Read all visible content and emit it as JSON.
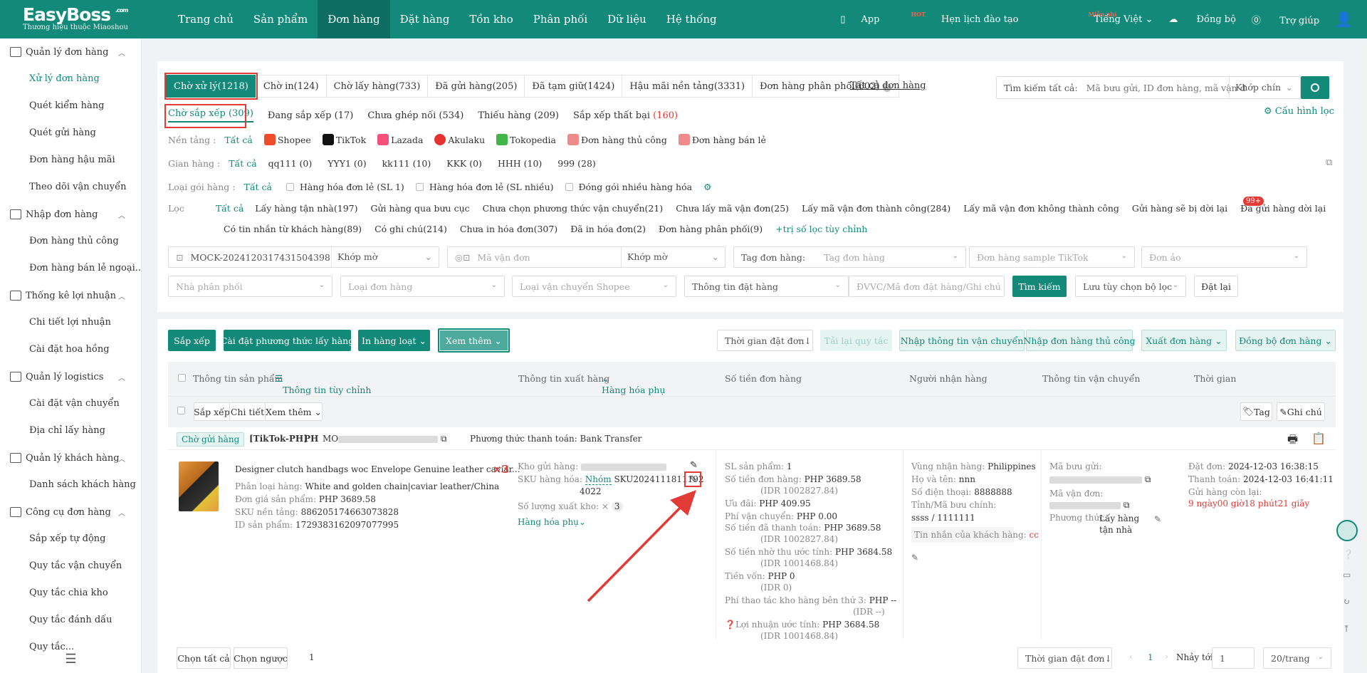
{
  "brand": {
    "name": "EasyBoss",
    "suffix": ".com",
    "tagline": "Thương hiệu thuộc Miaoshou"
  },
  "topnav": [
    "Trang chủ",
    "Sản phẩm",
    "Đơn hàng",
    "Đặt hàng",
    "Tồn kho",
    "Phân phối",
    "Dữ liệu",
    "Hệ thống"
  ],
  "topright": {
    "app": "App",
    "app_badge": "HOT",
    "training": "Hẹn lịch đào tạo",
    "training_badge": "Miễn phí",
    "language": "Tiếng Việt",
    "sync": "Đồng bộ",
    "help": "Trợ giúp"
  },
  "sidebar": [
    {
      "group": "Quản lý đơn hàng",
      "items": [
        "Xử lý đơn hàng",
        "Quét kiểm hàng",
        "Quét gửi hàng",
        "Đơn hàng hậu mãi",
        "Theo dõi vận chuyển"
      ]
    },
    {
      "group": "Nhập đơn hàng",
      "items": [
        "Đơn hàng thủ công",
        "Đơn hàng bán lẻ ngoại..."
      ]
    },
    {
      "group": "Thống kê lợi nhuận",
      "items": [
        "Chi tiết lợi nhuận",
        "Cài đặt hoa hồng"
      ]
    },
    {
      "group": "Quản lý logistics",
      "items": [
        "Cài đặt vận chuyển",
        "Địa chỉ lấy hàng"
      ]
    },
    {
      "group": "Quản lý khách hàng",
      "items": [
        "Danh sách khách hàng"
      ]
    },
    {
      "group": "Công cụ đơn hàng",
      "items": [
        "Sắp xếp tự động",
        "Quy tắc vận chuyển",
        "Quy tắc chia kho",
        "Quy tắc đánh dấu",
        "Quy tắc..."
      ]
    }
  ],
  "status_tabs": [
    "Chờ xử lý(1218)",
    "Chờ in(124)",
    "Chờ lấy hàng(733)",
    "Đã gửi hàng(205)",
    "Đã tạm giữ(1424)",
    "Hậu mãi nền tảng(3331)",
    "Đơn hàng phân phối(602)"
  ],
  "all_orders_link": "Tất cả đơn hàng",
  "search": {
    "label": "Tìm kiếm tất cả:",
    "placeholder": "Mã bưu gửi, ID đơn hàng, mã vận đơn",
    "match": "Khớp chín"
  },
  "config_filter": "Cấu hình lọc",
  "subtabs": [
    {
      "label": "Chờ sắp xếp (309)",
      "count": ""
    },
    {
      "label": "Đang sắp xếp (17)",
      "count": ""
    },
    {
      "label": "Chưa ghép nối (534)",
      "count": ""
    },
    {
      "label": "Thiếu hàng (209)",
      "count": ""
    },
    {
      "label": "Sắp xếp thất bại ",
      "count": "(160)"
    }
  ],
  "filters": {
    "platform_label": "Nền tảng :",
    "platforms": [
      "Tất cả",
      "Shopee",
      "TikTok",
      "Lazada",
      "Akulaku",
      "Tokopedia",
      "Đơn hàng thủ công",
      "Đơn hàng bán lẻ"
    ],
    "shop_label": "Gian hàng :",
    "shops": [
      "Tất cả",
      "qq111 (0)",
      "YYY1 (0)",
      "kk111 (10)",
      "KKK (0)",
      "HHH (10)",
      "999 (28)"
    ],
    "pkg_label": "Loại gói hàng :",
    "pkgs": [
      "Tất cả",
      "Hàng hóa đơn lẻ (SL 1)",
      "Hàng hóa đơn lẻ (SL nhiều)",
      "Đóng gói nhiều hàng hóa"
    ],
    "filter_label": "Lọc",
    "filter_row1": [
      "Tất cả",
      "Lấy hàng tận nhà(197)",
      "Gửi hàng qua bưu cục",
      "Chưa chọn phương thức vận chuyển(21)",
      "Chưa lấy mã vận đơn(25)",
      "Lấy mã vận đơn thành công(284)",
      "Lấy mã vận đơn không thành công",
      "Gửi hàng sẽ bị dời lại",
      "Đã gửi hàng dời lại"
    ],
    "badge": "99+",
    "filter_row2": [
      "Có tin nhắn từ khách hàng(89)",
      "Có ghi chú(214)",
      "Chưa in hóa đơn(307)",
      "Đã in hóa đơn(2)",
      "Đơn hàng phân phối(9)",
      "+trị số lọc tùy chỉnh"
    ]
  },
  "fields": {
    "f1": "MOCK-20241203174315043​98",
    "f1m": "Khớp mờ",
    "f2": "Mã vận đơn",
    "f2m": "Khớp mờ",
    "f3l": "Tag đơn hàng:",
    "f3": "Tag đơn hàng",
    "f4": "Đơn hàng sample TikTok",
    "f5": "Đơn ảo",
    "f6": "Nhà phân phối",
    "f7": "Loại đơn hàng",
    "f8": "Loại vận chuyển Shopee",
    "f9": "Thông tin đặt hàng",
    "f10": "ĐVVC/Mã đơn đặt hàng/Ghi chú",
    "search_btn": "Tìm kiếm",
    "save_btn": "Lưu tùy chọn bộ lọc",
    "reset_btn": "Đặt lại"
  },
  "actions": {
    "sort": "Sắp xếp",
    "pickup": "Cài đặt phương thức lấy hàng",
    "print": "In hàng loạt",
    "more": "Xem thêm",
    "time": "Thời gian đặt đơn↓",
    "reload": "Tải lại quy tắc",
    "import_ship": "Nhập thông tin vận chuyển",
    "import_manual": "Nhập đơn hàng thủ công",
    "export": "Xuất đơn hàng",
    "sync": "Đồng bộ đơn hàng"
  },
  "table_headers": {
    "product": "Thông tin sản phẩm",
    "custom": "Thông tin tùy chỉnh",
    "ship": "Thông tin xuất hàng",
    "sub": "Hàng hóa phụ",
    "amount": "Số tiền đơn hàng",
    "receiver": "Người nhận hàng",
    "logistics": "Thông tin vận chuyển",
    "time": "Thời gian"
  },
  "subbar": {
    "sort": "Sắp xếp",
    "detail": "Chi tiết",
    "more": "Xem thêm",
    "tag": "Tag",
    "note": "Ghi chú"
  },
  "order": {
    "status": "Chờ gửi hàng",
    "shop": "[TikTok-PH]",
    "country": "PH",
    "id_prefix": "MO",
    "payment": "Phương thức thanh toán: Bank Transfer",
    "product_title": "Designer clutch handbags woc Envelope Genuine leather caviar...",
    "qty": "×3",
    "variant_l": "Phân loại hàng:",
    "variant": "White and golden chain|caviar leather/China",
    "price_l": "Đơn giá sản phẩm:",
    "price": "PHP 3689.58",
    "sku_l": "SKU nền tảng:",
    "sku": "886205174663073828",
    "pid_l": "ID sản phẩm:",
    "pid": "1729383162097077995",
    "wh_l": "Kho gửi hàng:",
    "skuh_l": "SKU hàng hóa:",
    "group": "Nhóm",
    "skuh": "SKU2024111811192",
    "skuh2": "4022",
    "outqty_l": "Số lượng xuất kho:",
    "outqty": "3",
    "subgoods": "Hàng hóa phụ",
    "amounts": [
      {
        "l": "SL sản phẩm:",
        "v": "1",
        "s": ""
      },
      {
        "l": "Số tiền đơn hàng:",
        "v": "PHP 3689.58",
        "s": "(IDR 1002827.84)"
      },
      {
        "l": "Ưu đãi:",
        "v": "PHP 409.95",
        "s": ""
      },
      {
        "l": "Phí vận chuyển:",
        "v": "PHP 0.00",
        "s": ""
      },
      {
        "l": "Số tiền đã thanh toán:",
        "v": "PHP 3689.58",
        "s": "(IDR 1002827.84)"
      },
      {
        "l": "Số tiền nhờ thu ước tính:",
        "v": "PHP 3684.58",
        "s": "(IDR 1001468.84)"
      },
      {
        "l": "Tiền vốn:",
        "v": "PHP 0",
        "s": "(IDR 0)"
      },
      {
        "l": "Phí thao tác kho hàng bên thứ 3:",
        "v": "PHP --",
        "s": "(IDR --)"
      },
      {
        "l": "Lợi nhuận ước tính:",
        "v": "PHP 3684.58",
        "s": "(IDR 1001468.84)"
      }
    ],
    "region_l": "Vùng nhận hàng:",
    "region": "Philippines",
    "name_l": "Họ và tên:",
    "name": "nnn",
    "phone_l": "Số điện thoại:",
    "phone": "8888888",
    "prov_l": "Tỉnh/Mã bưu chính:",
    "prov": "ssss / 1111111",
    "msg_l": "Tin nhắn của khách hàng:",
    "msg": "cc",
    "post_l": "Mã bưu gửi:",
    "track_l": "Mã vận đơn:",
    "method_l": "Phương thức:",
    "method": "Lấy hàng tận nhà",
    "placed_l": "Đặt đơn:",
    "placed": "2024-12-03 16:38:15",
    "paid_l": "Thanh toán:",
    "paid": "2024-12-03 16:41:11",
    "remain_l": "Gửi hàng còn lại:",
    "remain": "9 ngày00 giờ18 phút21 giây"
  },
  "footer": {
    "select_all": "Chọn tất cả",
    "invert": "Chọn ngược",
    "count": "1",
    "sort": "Thời gian đặt đơn↓",
    "page": "1",
    "goto": "Nhảy tới",
    "goto_val": "1",
    "per_page": "20/trang"
  },
  "colors": {
    "primary": "#13897a",
    "highlight": "#e23b36"
  }
}
